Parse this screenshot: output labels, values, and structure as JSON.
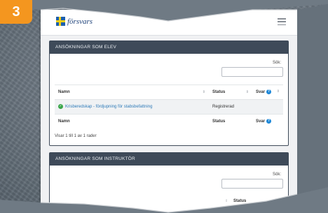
{
  "step": "3",
  "header": {
    "logo_text": "försvars"
  },
  "student_panel": {
    "title": "ANSÖKNINGAR SOM ELEV",
    "search_label": "Sök:",
    "columns": [
      "Namn",
      "Status",
      "Svar"
    ],
    "rows": [
      {
        "name": "Krisberedskap - fördjupning för stabsbefattning",
        "status": "Registrerad",
        "answer": ""
      }
    ],
    "footer_columns": [
      "Namn",
      "Status",
      "Svar"
    ],
    "info": "Visar 1 till 1 av 1 rader"
  },
  "instructor_panel": {
    "title": "ANSÖKNINGAR SOM INSTRUKTÖR",
    "search_label": "Sök:",
    "columns": [
      "Status"
    ]
  },
  "colors": {
    "badge": "#f4961f",
    "panel_header": "#3e4a59",
    "link": "#2f7bb8",
    "ok": "#3aa64a",
    "help": "#1e88d8"
  }
}
